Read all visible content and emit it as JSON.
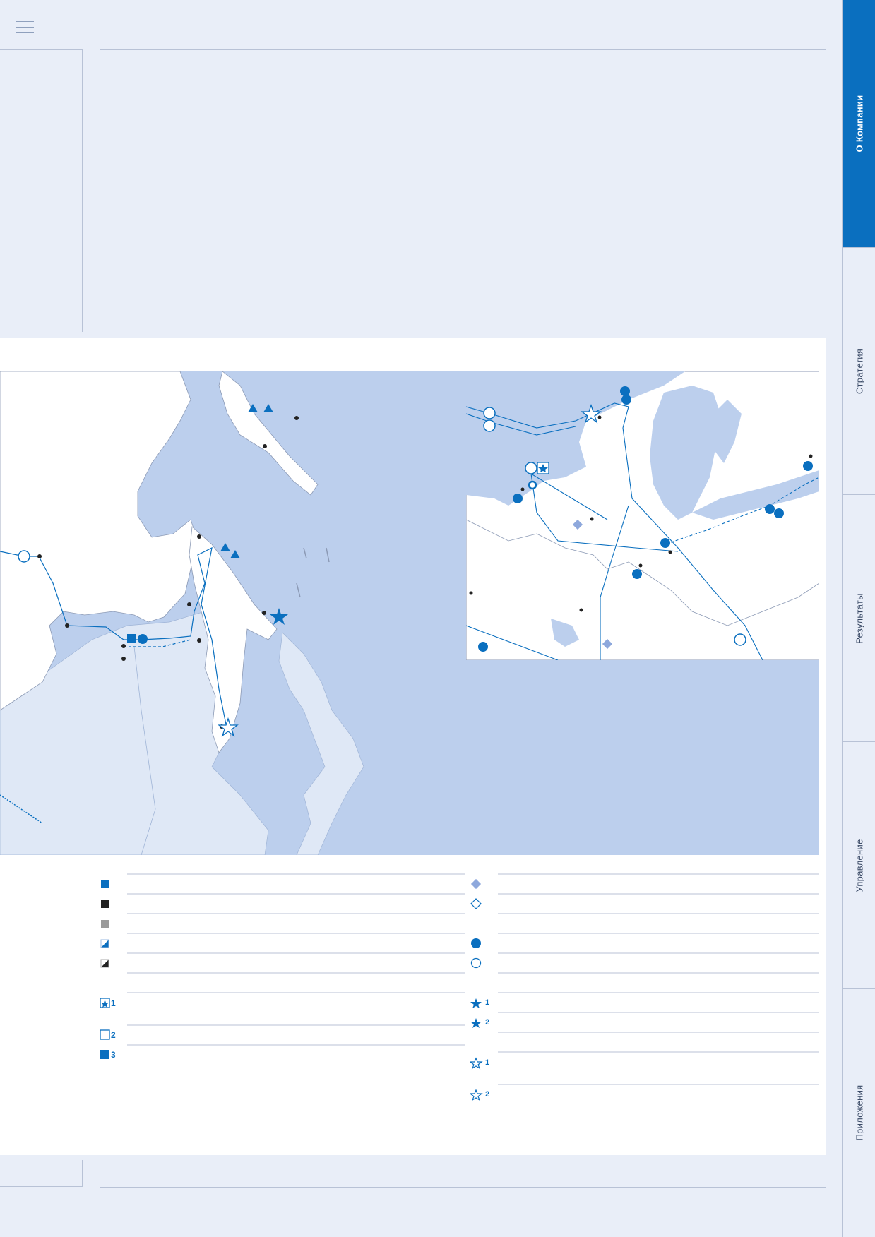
{
  "colors": {
    "accent": "#0a6fbf",
    "sea": "#bccfed",
    "neighbor_land": "#dfe8f6",
    "land": "#ffffff",
    "page_bg": "#e9eef8"
  },
  "header": {
    "menu_icon": "hamburger-menu-icon"
  },
  "sidebar": {
    "tabs": [
      {
        "label": "О Компании",
        "active": true
      },
      {
        "label": "Стратегия",
        "active": false
      },
      {
        "label": "Результаты",
        "active": false
      },
      {
        "label": "Управление",
        "active": false
      },
      {
        "label": "Приложения",
        "active": false
      }
    ]
  },
  "legend": {
    "left_numbers": [
      "1",
      "2",
      "3"
    ],
    "right_numbers": [
      "1",
      "2",
      "1",
      "2"
    ]
  }
}
